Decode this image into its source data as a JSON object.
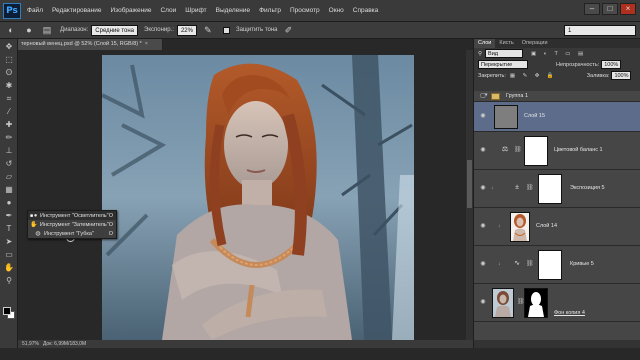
{
  "app": {
    "logo": "Ps",
    "accent": "#31a8ff"
  },
  "menu": [
    "Файл",
    "Редактирование",
    "Изображение",
    "Слои",
    "Шрифт",
    "Выделение",
    "Фильтр",
    "Просмотр",
    "Окно",
    "Справка"
  ],
  "window_controls": {
    "minimize": "–",
    "maximize": "□",
    "close": "×"
  },
  "options_bar": {
    "tool_icon": "dodge-tool-icon",
    "range_label": "Диапазон:",
    "range_value": "Средние тона",
    "exposure_label": "Экспонир.:",
    "exposure_value": "22%",
    "protect_tones_label": "Защитить тона",
    "workspace_value": "1"
  },
  "document": {
    "tab_title": "терновый венец.psd @ 52% (Слой 15, RGB/8) *",
    "close_glyph": "×",
    "zoom": "51,97%",
    "doc_size": "Док: 6,99M/183,0M"
  },
  "tools": [
    "move",
    "marquee",
    "lasso",
    "quick-select",
    "crop",
    "eyedropper",
    "healing",
    "brush",
    "stamp",
    "history-brush",
    "eraser",
    "gradient",
    "dodge",
    "pen",
    "type",
    "path-select",
    "shape",
    "hand",
    "zoom"
  ],
  "flyout": [
    {
      "label": "Инструмент \"Осветлитель\"",
      "key": "O",
      "active": true,
      "icon": "dodge-icon"
    },
    {
      "label": "Инструмент \"Затемнитель\"",
      "key": "O",
      "active": false,
      "icon": "burn-icon"
    },
    {
      "label": "Инструмент \"Губка\"",
      "key": "O",
      "active": false,
      "icon": "sponge-icon"
    }
  ],
  "panel": {
    "tabs": [
      "Слои",
      "Кисть",
      "Операции"
    ],
    "kind_filter": "Вид",
    "blend_mode": "Перекрытие",
    "opacity_label": "Непрозрачность:",
    "opacity_value": "100%",
    "lock_label": "Закрепить:",
    "fill_label": "Заливка:",
    "fill_value": "100%",
    "group_name": "Группа 1",
    "layers": [
      {
        "name": "Слой 15",
        "type": "gray-fill",
        "selected": true
      },
      {
        "name": "Цветовой баланс 1",
        "type": "adjustment",
        "icon": "balance-icon",
        "selected": false
      },
      {
        "name": "Экспозиция 5",
        "type": "adjustment",
        "icon": "exposure-icon",
        "selected": false
      },
      {
        "name": "Слой 14",
        "type": "image",
        "selected": false
      },
      {
        "name": "Кривые 5",
        "type": "adjustment",
        "icon": "curves-icon",
        "selected": false
      },
      {
        "name": "Фон копия 4",
        "type": "photo",
        "selected": false
      }
    ]
  }
}
